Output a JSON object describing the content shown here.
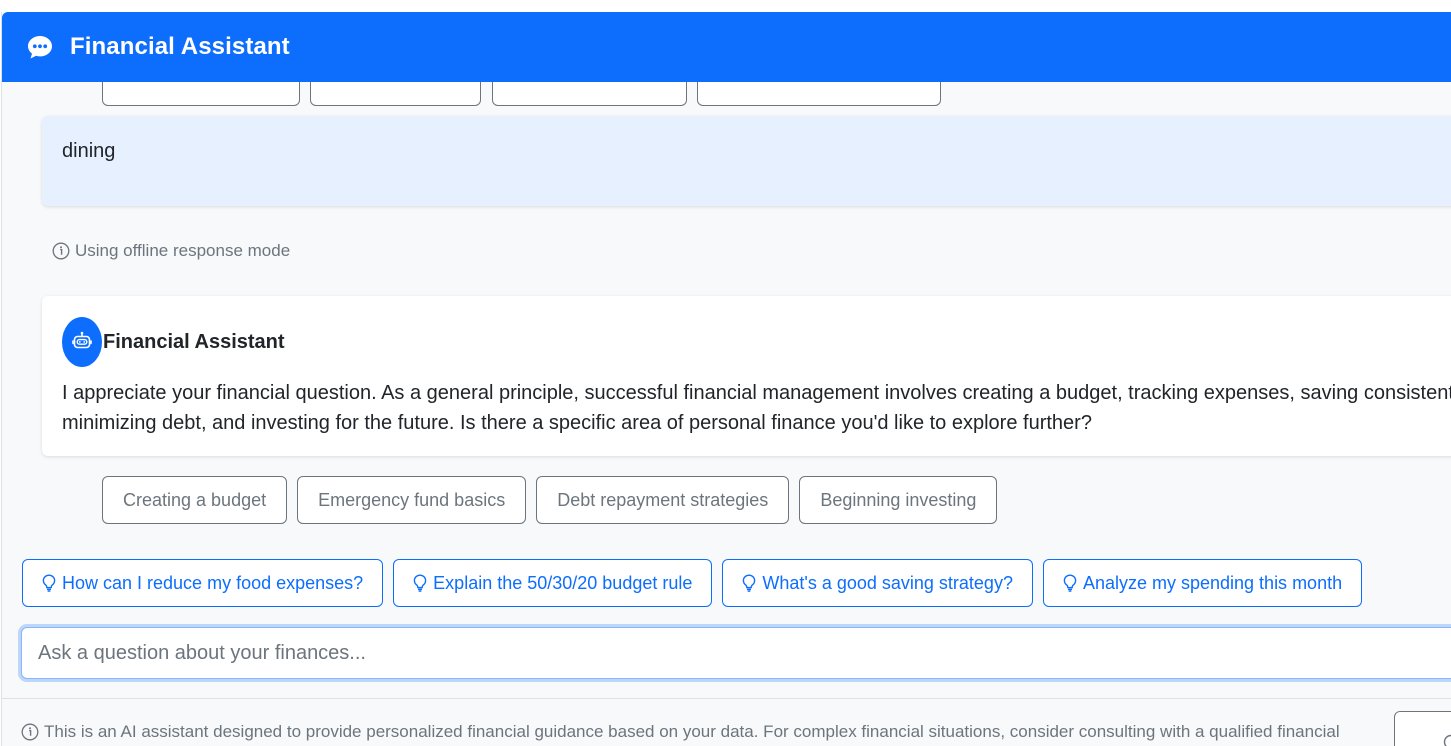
{
  "header": {
    "title": "Financial Assistant",
    "icon": "chat-bubble-icon"
  },
  "messages": {
    "user_text": "dining",
    "offline_note": "Using offline response mode",
    "bot_name": "Financial Assistant",
    "bot_line1": "I appreciate your financial question. As a general principle, successful financial management involves creating a budget, tracking expenses, saving consistently,",
    "bot_line2": "minimizing debt, and investing for the future. Is there a specific area of personal finance you'd like to explore further?"
  },
  "follow_up_suggestions": [
    "Creating a budget",
    "Emergency fund basics",
    "Debt repayment strategies",
    "Beginning investing"
  ],
  "quick_questions": [
    "How can I reduce my food expenses?",
    "Explain the 50/30/20 budget rule",
    "What's a good saving strategy?",
    "Analyze my spending this month"
  ],
  "input": {
    "placeholder": "Ask a question about your finances...",
    "value": ""
  },
  "footer": {
    "disclaimer": "This is an AI assistant designed to provide personalized financial guidance based on your data. For complex financial situations, consider consulting with a qualified financial"
  },
  "colors": {
    "primary": "#0d6efd",
    "user_bubble": "#e7f0fe",
    "muted": "#6c757d",
    "background": "#f8f9fa"
  }
}
